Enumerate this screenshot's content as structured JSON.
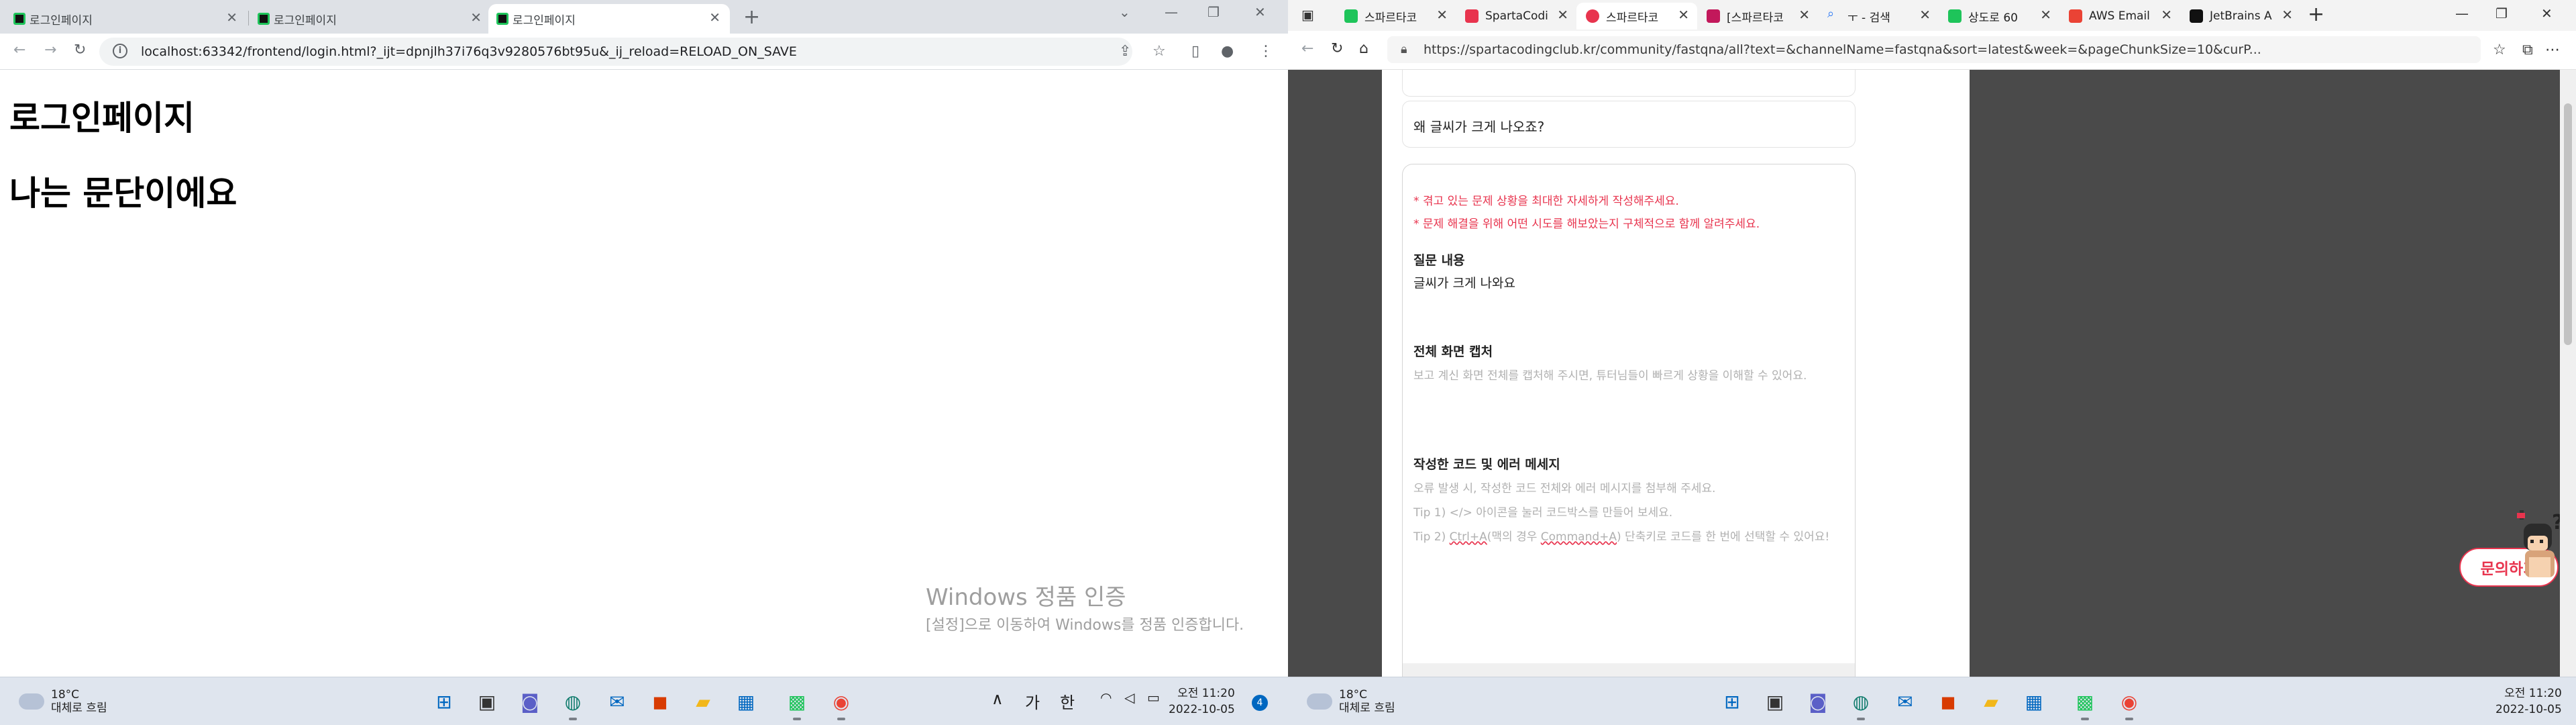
{
  "left_window": {
    "tabs": [
      {
        "label": "로그인페이지"
      },
      {
        "label": "로그인페이지"
      },
      {
        "label": "로그인페이지"
      }
    ],
    "url": "localhost:63342/frontend/login.html?_ijt=dpnjlh37i76q3v9280576bt95u&_ij_reload=RELOAD_ON_SAVE",
    "page": {
      "heading1": "로그인페이지",
      "heading2": "나는 문단이에요"
    },
    "activation": {
      "title": "Windows 정품 인증",
      "text": "[설정]으로 이동하여 Windows를 정품 인증합니다."
    }
  },
  "right_window": {
    "tabs": [
      {
        "label": "스파르타코",
        "color": "#1ec45a"
      },
      {
        "label": "SpartaCodi",
        "color": "#e8344e"
      },
      {
        "label": "스파르타코",
        "color": "#e8344e"
      },
      {
        "label": "[스파르타코",
        "color": "#c2185b"
      },
      {
        "label": "ㅜ - 검색",
        "color": "#2b79f5"
      },
      {
        "label": "상도로 60",
        "color": "#1ec45a"
      },
      {
        "label": "AWS Email",
        "color": "#ea4335"
      },
      {
        "label": "JetBrains A",
        "color": "#111111"
      }
    ],
    "url": "https://spartacodingclub.kr/community/fastqna/all?text=&channelName=fastqna&sort=latest&week=&pageChunkSize=10&curP...",
    "question_title": "왜 글씨가 크게 나오죠?",
    "warnings": [
      "* 겪고 있는 문제 상황을 최대한 자세하게 작성해주세요.",
      "* 문제 해결을 위해 어떤 시도를 해보았는지 구체적으로 함께 알려주세요."
    ],
    "sections": {
      "question_heading": "질문 내용",
      "question_body": "글씨가 크게 나와요",
      "capture_heading": "전체 화면 캡처",
      "capture_hint": "보고 계신 화면 전체를 캡처해 주시면, 튜터님들이 빠르게 상황을 이해할 수 있어요.",
      "code_heading": "작성한 코드 및 에러 메세지",
      "code_hint1": "오류 발생 시, 작성한 코드 전체와 에러 메시지를 첨부해 주세요.",
      "code_hint2": "Tip 1) </> 아이콘을 눌러 코드박스를 만들어 보세요.",
      "code_hint3_a": "Tip 2) ",
      "code_hint3_b": "Ctrl+A",
      "code_hint3_c": "(맥의 경우 ",
      "code_hint3_d": "Command+A",
      "code_hint3_e": ") 단축키로 코드를 한 번에 선택할 수 있어요!"
    },
    "inquiry_button": "문의하기"
  },
  "taskbar": {
    "weather_temp": "18°C",
    "weather_desc": "대체로 흐림",
    "ime1": "가",
    "ime2": "한",
    "time_left": "오전 11:20",
    "date_left": "2022-10-05",
    "notif_count": "4",
    "time_right": "오전 11:20",
    "date_right": "2022-10-05"
  }
}
